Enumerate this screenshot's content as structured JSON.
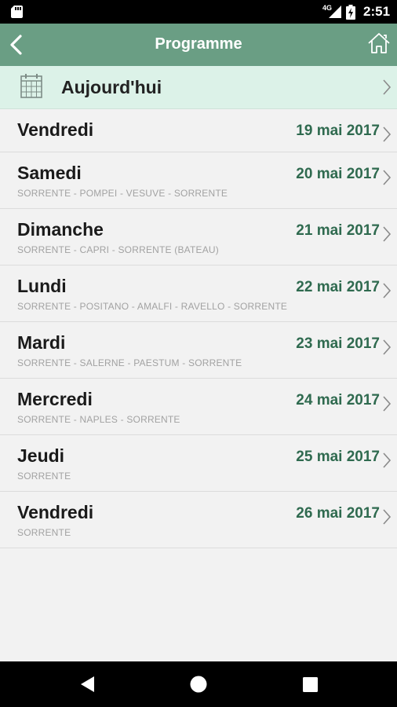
{
  "status_bar": {
    "network": "4G",
    "time": "2:51"
  },
  "header": {
    "title": "Programme"
  },
  "today": {
    "label": "Aujourd'hui"
  },
  "days": [
    {
      "name": "Vendredi",
      "date": "19 mai 2017",
      "route": ""
    },
    {
      "name": "Samedi",
      "date": "20 mai 2017",
      "route": "SORRENTE - POMPEI - VESUVE - SORRENTE"
    },
    {
      "name": "Dimanche",
      "date": "21 mai 2017",
      "route": "SORRENTE - CAPRI - SORRENTE (BATEAU)"
    },
    {
      "name": "Lundi",
      "date": "22 mai 2017",
      "route": "SORRENTE - POSITANO - AMALFI - RAVELLO - SORRENTE"
    },
    {
      "name": "Mardi",
      "date": "23 mai 2017",
      "route": "SORRENTE - SALERNE - PAESTUM - SORRENTE"
    },
    {
      "name": "Mercredi",
      "date": "24 mai 2017",
      "route": "SORRENTE - NAPLES - SORRENTE"
    },
    {
      "name": "Jeudi",
      "date": "25 mai 2017",
      "route": "SORRENTE"
    },
    {
      "name": "Vendredi",
      "date": "26 mai 2017",
      "route": "SORRENTE"
    }
  ],
  "icons": {
    "back": "chevron-left-icon",
    "home": "home-icon",
    "calendar": "calendar-icon",
    "row_chevron": "chevron-right-icon"
  },
  "colors": {
    "app_bar": "#6a9e84",
    "today_row": "#dcf2e8",
    "date_text": "#2f6a4f",
    "route_text": "#a2a2a2"
  }
}
